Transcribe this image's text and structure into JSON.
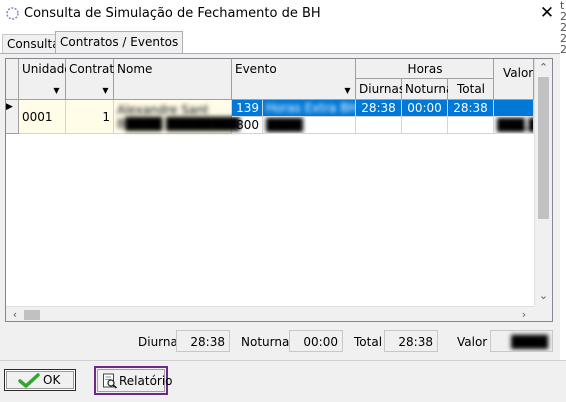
{
  "window": {
    "title": "Consulta de Simulação de Fechamento de BH",
    "close_glyph": "✕"
  },
  "tabs": [
    {
      "label": "Consulta",
      "active": false
    },
    {
      "label": "Contratos / Eventos",
      "active": true
    }
  ],
  "grid": {
    "columns": {
      "unidade": "Unidade",
      "contrato": "Contrato",
      "nome": "Nome",
      "evento": "Evento",
      "horas": "Horas",
      "diurnas": "Diurnas",
      "noturnas": "Noturnas",
      "total": "Total",
      "valor": "Valor"
    },
    "row": {
      "indicator": "▶",
      "unidade": "0001",
      "contrato": "1",
      "nome_line1": "Alexandre Sant",
      "nome_line2": "B████ ████████",
      "eventos": [
        {
          "code": "139",
          "desc": "Horas Extra BH",
          "diurnas": "28:38",
          "noturnas": "00:00",
          "total": "28:38",
          "valor": ""
        },
        {
          "code": "800",
          "desc": "████",
          "diurnas": "",
          "noturnas": "",
          "total": "",
          "valor": "███,█"
        }
      ]
    }
  },
  "totals": {
    "diurnas_label": "Diurnas",
    "diurnas_value": "28:38",
    "noturnas_label": "Noturnas",
    "noturnas_value": "00:00",
    "total_label": "Total",
    "total_value": "28:38",
    "valor_label": "Valor",
    "valor_value": "████"
  },
  "buttons": {
    "ok": "OK",
    "relatorio": "Relatório"
  },
  "colors": {
    "selection": "#0078d7",
    "highlight_border": "#6b2a86",
    "row_bg": "#fffde8",
    "ok_check": "#2ea82e"
  },
  "edge_text": "t 2 2 2 2"
}
